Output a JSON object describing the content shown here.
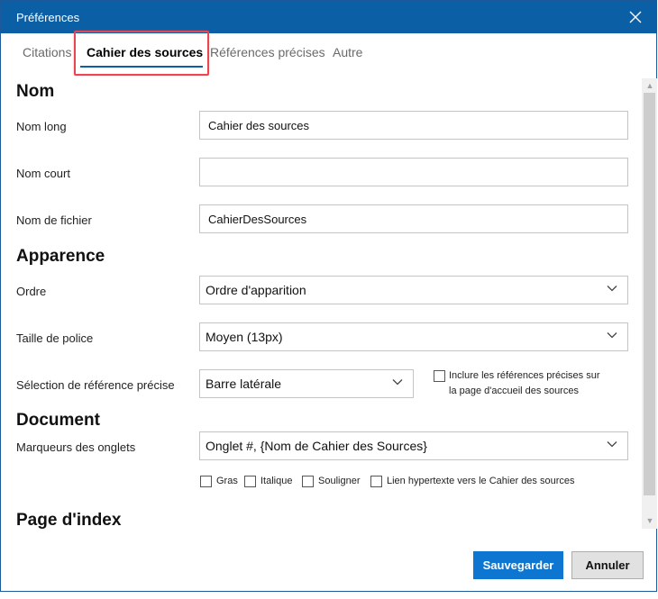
{
  "window": {
    "title": "Préférences"
  },
  "tabs": [
    {
      "label": "Citations"
    },
    {
      "label": "Cahier des sources"
    },
    {
      "label": "Références précises"
    },
    {
      "label": "Autre"
    }
  ],
  "sections": {
    "nom": "Nom",
    "apparence": "Apparence",
    "document": "Document",
    "index": "Page d'index"
  },
  "nom": {
    "long_label": "Nom long",
    "long_value": "Cahier des sources",
    "court_label": "Nom court",
    "court_value": "",
    "fichier_label": "Nom de fichier",
    "fichier_value": "CahierDesSources"
  },
  "apparence": {
    "ordre_label": "Ordre",
    "ordre_value": "Ordre d'apparition",
    "taille_label": "Taille de police",
    "taille_value": "Moyen (13px)",
    "selection_label": "Sélection de référence précise",
    "selection_value": "Barre latérale",
    "inclure_line1": "Inclure les références précises sur",
    "inclure_line2": "la page d'accueil des sources",
    "inclure_checked": false
  },
  "document": {
    "marqueurs_label": "Marqueurs des onglets",
    "marqueurs_value": "Onglet #, {Nom de Cahier des Sources}",
    "options": [
      {
        "label": "Gras",
        "checked": false
      },
      {
        "label": "Italique",
        "checked": false
      },
      {
        "label": "Souligner",
        "checked": false
      },
      {
        "label": "Lien hypertexte vers le Cahier des sources",
        "checked": false
      }
    ]
  },
  "buttons": {
    "save": "Sauvegarder",
    "cancel": "Annuler"
  },
  "colors": {
    "titlebar": "#0b5fa5",
    "primary": "#0e76d1",
    "highlight": "#e8474f"
  }
}
